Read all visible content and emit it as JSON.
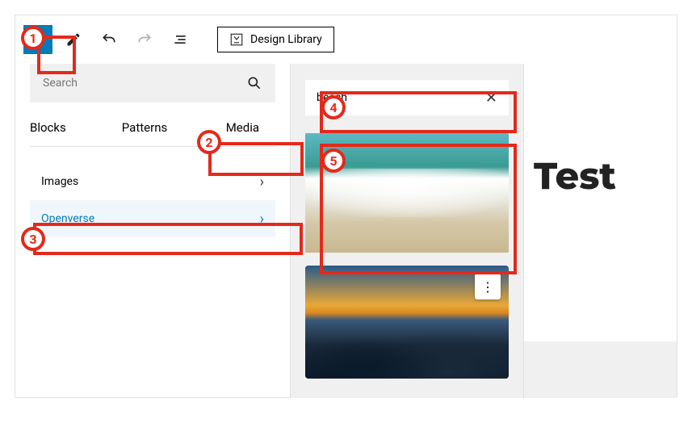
{
  "toolbar": {
    "design_library_label": "Design Library"
  },
  "inserter": {
    "search_placeholder": "Search",
    "tabs": {
      "blocks": "Blocks",
      "patterns": "Patterns",
      "media": "Media",
      "active": "media"
    },
    "categories": [
      {
        "label": "Images",
        "active": false
      },
      {
        "label": "Openverse",
        "active": true
      }
    ]
  },
  "media_panel": {
    "search_value": "beach"
  },
  "content": {
    "page_title": "Test"
  },
  "callouts": [
    "1",
    "2",
    "3",
    "4",
    "5"
  ]
}
